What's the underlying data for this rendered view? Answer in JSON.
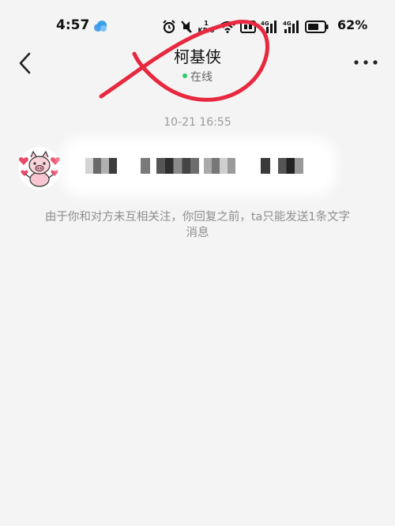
{
  "status_bar": {
    "time": "4:57",
    "net_speed_unit": "KB/S",
    "battery_percent": "62%",
    "icons": [
      "cloud-icon",
      "alarm-icon",
      "mute-icon",
      "wifi-icon",
      "hd-icon",
      "4g-signal-icon",
      "4g-signal-icon",
      "battery-icon"
    ]
  },
  "header": {
    "back_icon": "chevron-left-icon",
    "title": "柯基侠",
    "status": "在线",
    "more_icon": "more-dots-icon"
  },
  "conversation": {
    "timestamp": "10-21 16:55",
    "message": {
      "avatar_icon": "pig-avatar-icon",
      "text_redacted": true
    },
    "notice": "由于你和对方未互相关注，你回复之前，ta只能发送1条文字消息"
  },
  "colors": {
    "background": "#f4f4f4",
    "annotation_red": "#e8283f",
    "online_green": "#2ecc71",
    "muted_text": "#8e8e8e"
  }
}
